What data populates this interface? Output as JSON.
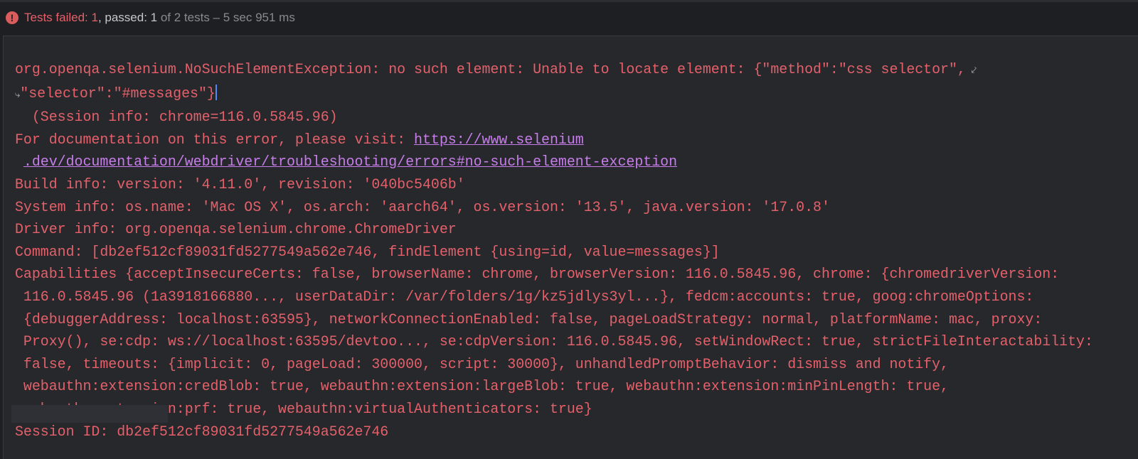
{
  "status": {
    "failed_label": "Tests failed: 1",
    "passed_label": ", passed: 1",
    "total_label": " of 2 tests",
    "duration_label": " – 5 sec 951 ms"
  },
  "console": {
    "lines": [
      "org.openqa.selenium.NoSuchElementException: no such element: Unable to locate element: {\"method\":\"css selector\",",
      "\"selector\":\"#messages\"}",
      "  (Session info: chrome=116.0.5845.96)",
      "For documentation on this error, please visit: ",
      "https://www.selenium",
      ".dev/documentation/webdriver/troubleshooting/errors#no-such-element-exception",
      "Build info: version: '4.11.0', revision: '040bc5406b'",
      "System info: os.name: 'Mac OS X', os.arch: 'aarch64', os.version: '13.5', java.version: '17.0.8'",
      "Driver info: org.openqa.selenium.chrome.ChromeDriver",
      "Command: [db2ef512cf89031fd5277549a562e746, findElement {using=id, value=messages}]",
      "Capabilities {acceptInsecureCerts: false, browserName: chrome, browserVersion: 116.0.5845.96, chrome: {chromedriverVersion:",
      " 116.0.5845.96 (1a3918166880..., userDataDir: /var/folders/1g/kz5jdlys3yl...}, fedcm:accounts: true, goog:chromeOptions:",
      " {debuggerAddress: localhost:63595}, networkConnectionEnabled: false, pageLoadStrategy: normal, platformName: mac, proxy:",
      " Proxy(), se:cdp: ws://localhost:63595/devtoo..., se:cdpVersion: 116.0.5845.96, setWindowRect: true, strictFileInteractability:",
      " false, timeouts: {implicit: 0, pageLoad: 300000, script: 30000}, unhandledPromptBehavior: dismiss and notify,",
      " webauthn:extension:credBlob: true, webauthn:extension:largeBlob: true, webauthn:extension:minPinLength: true,",
      " webauthn:extension:prf: true, webauthn:virtualAuthenticators: true}",
      "Session ID: db2ef512cf89031fd5277549a562e746"
    ]
  }
}
